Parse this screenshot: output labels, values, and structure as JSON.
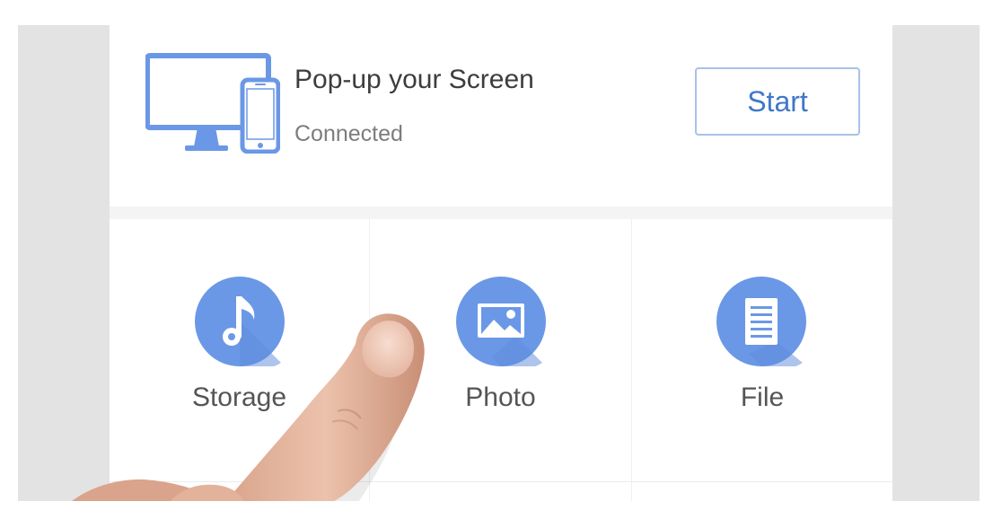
{
  "popup": {
    "title": "Pop-up your Screen",
    "status": "Connected",
    "start_label": "Start",
    "icon": "monitor-phone-icon"
  },
  "tiles": [
    {
      "label": "Storage",
      "icon": "music-note-icon"
    },
    {
      "label": "Photo",
      "icon": "image-icon"
    },
    {
      "label": "File",
      "icon": "document-icon"
    }
  ],
  "colors": {
    "accent": "#6b98e6",
    "accent_dark": "#4f7fd2",
    "button_text": "#3f78c7",
    "button_border": "#a8c2e8",
    "bezel": "#e3e3e3"
  }
}
